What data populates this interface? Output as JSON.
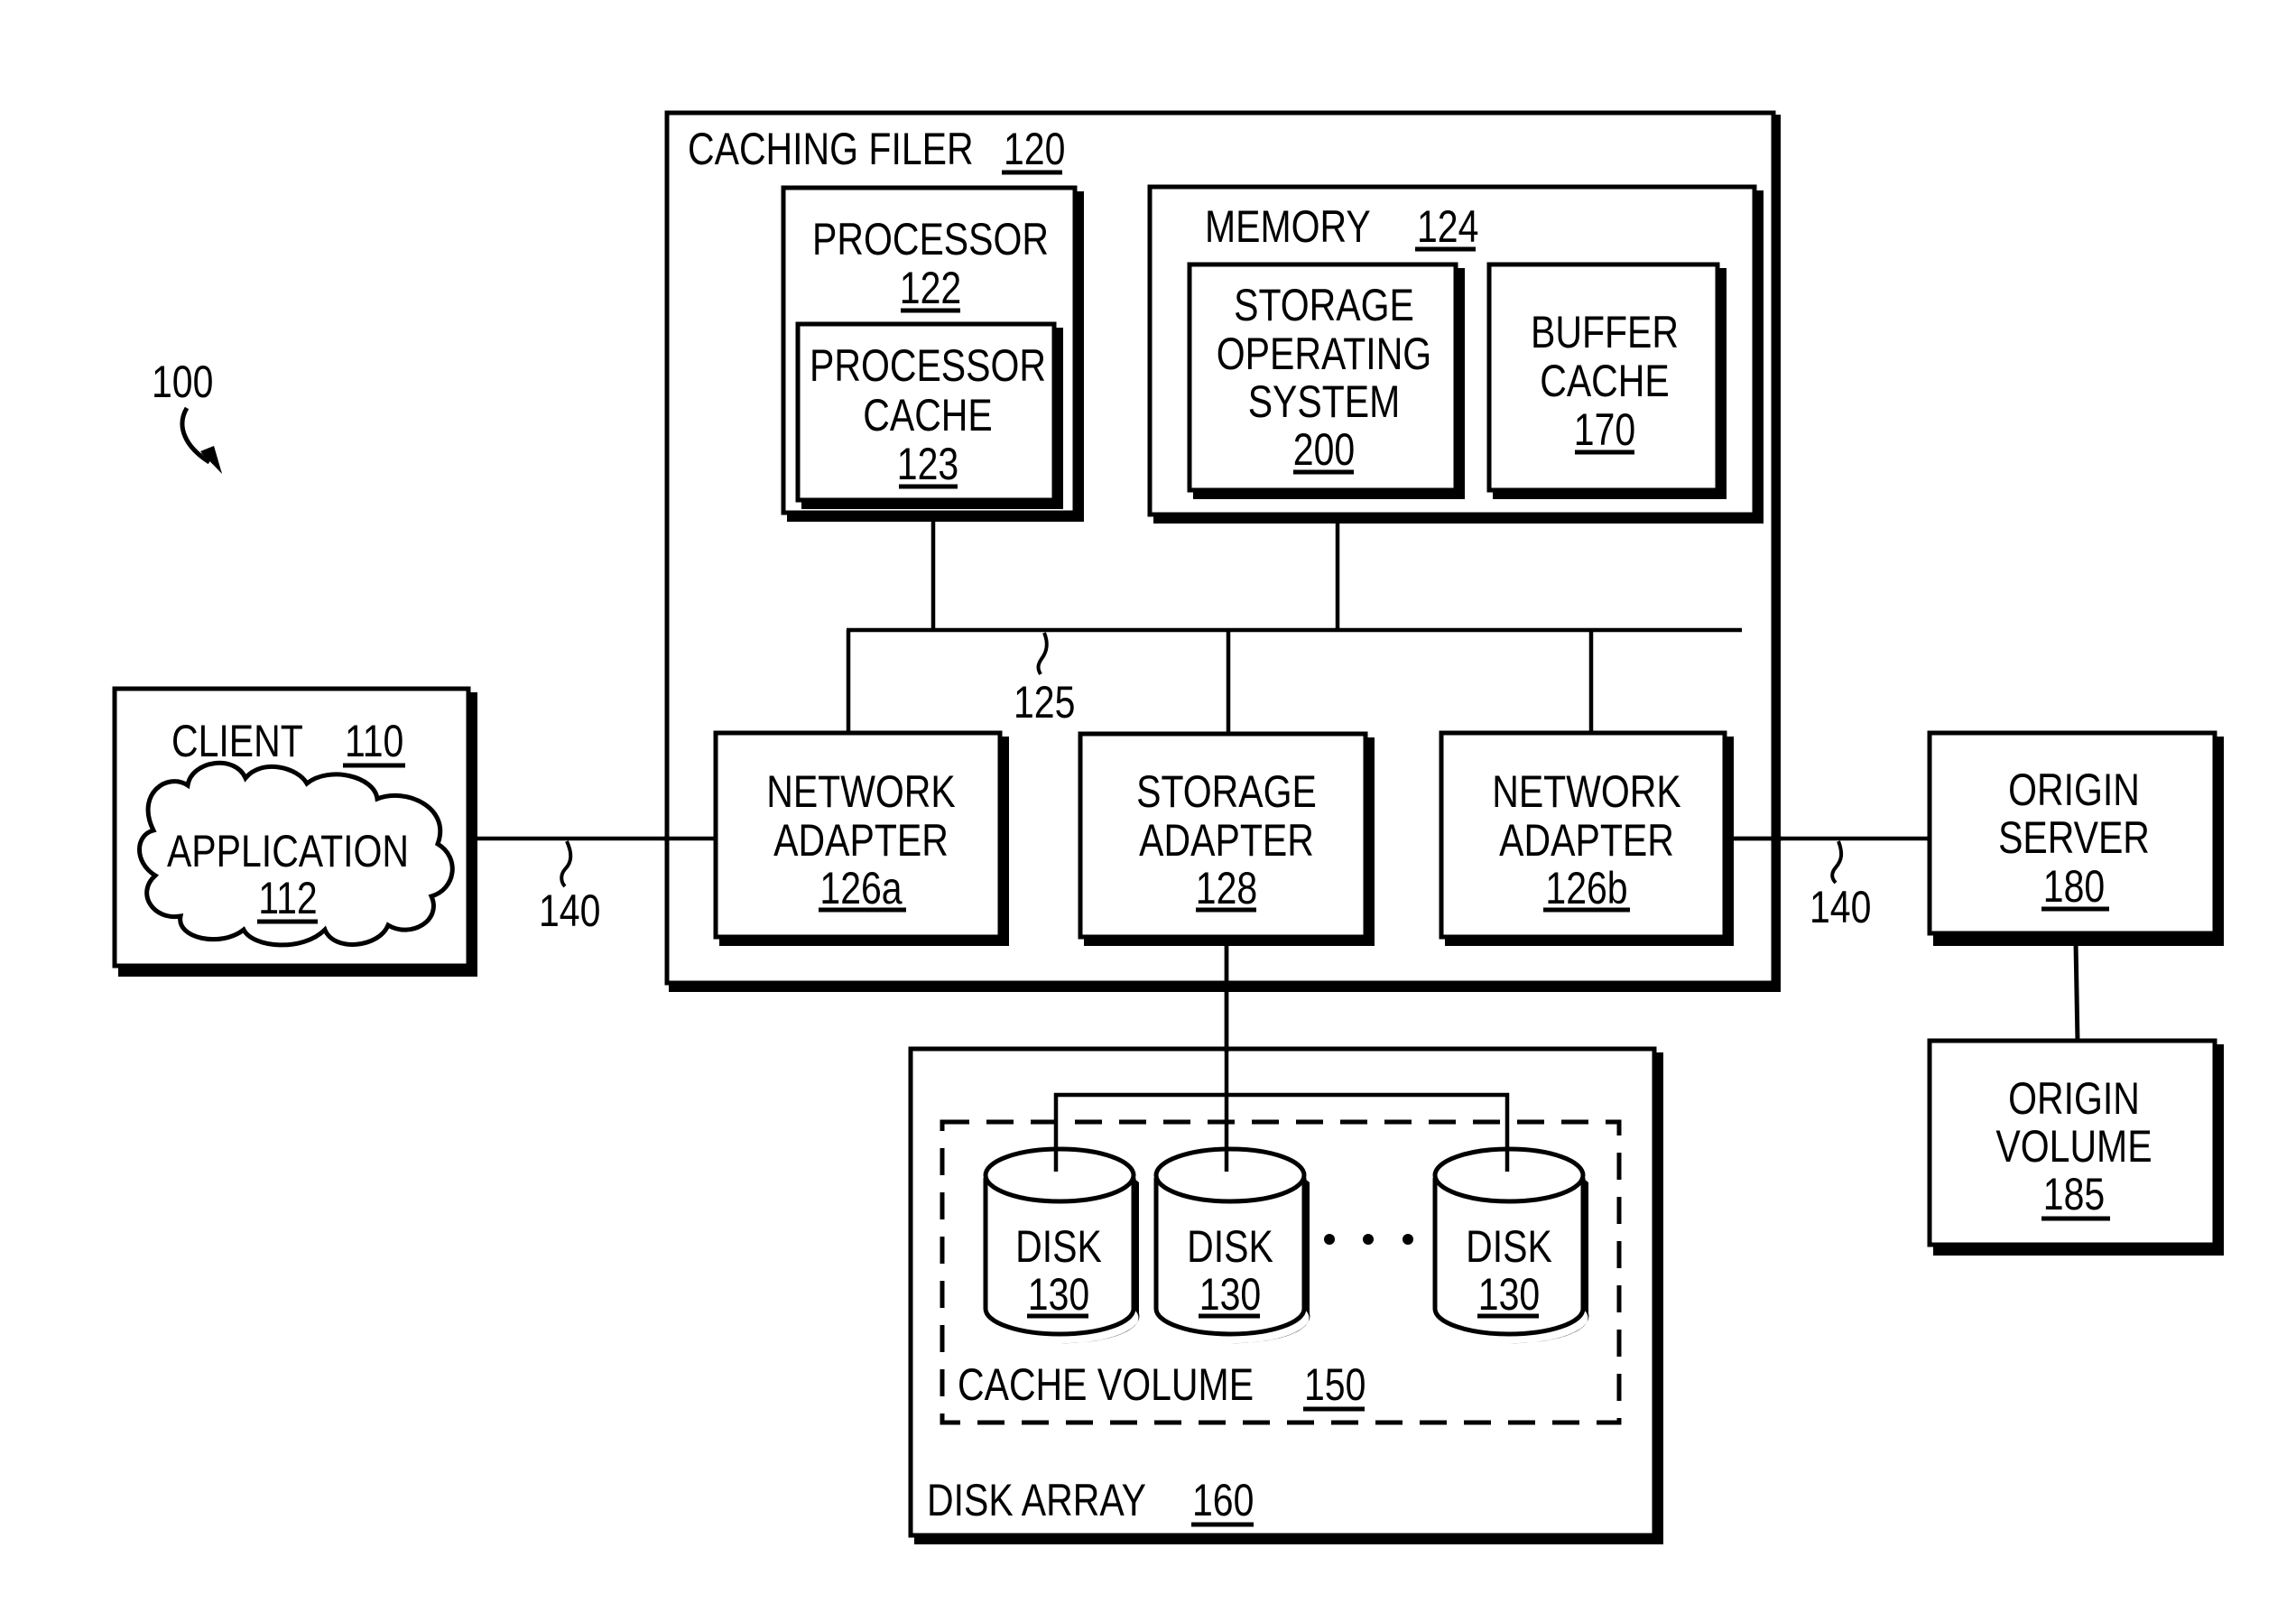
{
  "figure": {
    "ref": "100"
  },
  "client": {
    "title": "CLIENT",
    "ref": "110"
  },
  "application": {
    "title": "APPLICATION",
    "ref": "112"
  },
  "caching_filer": {
    "title": "CACHING FILER",
    "ref": "120"
  },
  "processor": {
    "title": "PROCESSOR",
    "ref": "122"
  },
  "processor_cache": {
    "lines": [
      "PROCESSOR",
      "CACHE"
    ],
    "ref": "123"
  },
  "memory": {
    "title": "MEMORY",
    "ref": "124"
  },
  "storage_os": {
    "lines": [
      "STORAGE",
      "OPERATING",
      "SYSTEM"
    ],
    "ref": "200"
  },
  "buffer_cache": {
    "lines": [
      "BUFFER",
      "CACHE"
    ],
    "ref": "170"
  },
  "bus": {
    "ref": "125"
  },
  "network_adapter_a": {
    "lines": [
      "NETWORK",
      "ADAPTER"
    ],
    "ref": "126a"
  },
  "storage_adapter": {
    "lines": [
      "STORAGE",
      "ADAPTER"
    ],
    "ref": "128"
  },
  "network_adapter_b": {
    "lines": [
      "NETWORK",
      "ADAPTER"
    ],
    "ref": "126b"
  },
  "network_left": {
    "ref": "140"
  },
  "network_right": {
    "ref": "140"
  },
  "origin_server": {
    "lines": [
      "ORIGIN",
      "SERVER"
    ],
    "ref": "180"
  },
  "origin_volume": {
    "lines": [
      "ORIGIN",
      "VOLUME"
    ],
    "ref": "185"
  },
  "disks": [
    {
      "title": "DISK",
      "ref": "130"
    },
    {
      "title": "DISK",
      "ref": "130"
    },
    {
      "title": "DISK",
      "ref": "130"
    }
  ],
  "ellipsis": "• • •",
  "cache_volume": {
    "title": "CACHE VOLUME",
    "ref": "150"
  },
  "disk_array": {
    "title": "DISK ARRAY",
    "ref": "160"
  }
}
